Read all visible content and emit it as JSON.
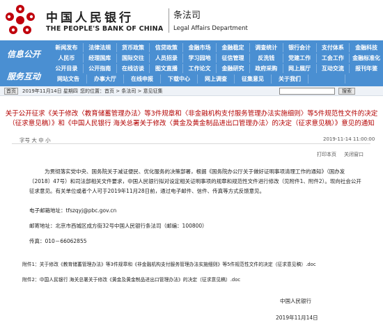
{
  "header": {
    "bank_zh": "中国人民银行",
    "bank_en": "THE PEOPLE'S BANK OF CHINA",
    "dept_zh": "条法司",
    "dept_en": "Legal Affairs Department",
    "brand_color": "#c0000c"
  },
  "nav": {
    "section1": "信息公开",
    "section2": "服务互动",
    "rows": [
      [
        "新闻发布",
        "法律法规",
        "货币政策",
        "信贷政策",
        "金融市场",
        "金融稳定",
        "调查统计",
        "银行会计",
        "支付体系",
        "金融科技"
      ],
      [
        "人民币",
        "经理国库",
        "国际交往",
        "人员招录",
        "学习园地",
        "征信管理",
        "反洗钱",
        "党建工作",
        "工会工作",
        "金融标准化"
      ],
      [
        "公开目录",
        "公开指南",
        "在线访谈",
        "图文直播",
        "工作论文",
        "金融研究",
        "政府采购",
        "网上展厅",
        "互动交流",
        "报刊年鉴"
      ],
      [
        "网站文告",
        "办事大厅",
        "在线申报",
        "下载中心",
        "网上调查",
        "征集意见",
        "关于我们",
        "",
        ""
      ]
    ],
    "accent": "#4a8fd2"
  },
  "breadcrumb": {
    "home_btn": "首页",
    "date": "2019年11月14日 星期四",
    "location": "您的位置：首页 > 条法司 > 意见征集",
    "search_btn": "搜索"
  },
  "article": {
    "title": "关于公开征求《关于修改〈教育储蓄管理办法〉等3件规章和〈非金融机构支付服务管理办法实施细则〉等5件规范性文件的决定（征求意见稿）》和《中国人民银行 海关总署关于修改〈黄金及黄金制品进出口管理办法〉的决定（征求意见稿）》意见的通知",
    "font_label": "字号 大 中 小",
    "date": "2019-11-14 11:00:00",
    "print": "打印本页",
    "close": "关闭窗口",
    "body": "为贯彻落实党中央、国务院关于减证便民、优化服务的决策部署，根据《国务院办公厅关于做好证明事项清理工作的通知》（国办发〔2018〕47号）和司法部相关文件要求，中国人民银行拟对设定相关证明事项的规章和规范性文件进行修改（见附件1、附件2）。现向社会公开征求意见。有关单位或者个人可于2019年11月28日前，通过电子邮件、信件、传真等方式反馈意见。",
    "email": "电子邮箱地址：tfszqyj@pbc.gov.cn",
    "address": "邮寄地址：北京市西城区成方街32号中国人民银行条法司（邮编：100800）",
    "fax": "传真：010－66062855",
    "attach1": "附件1：关于修改《教育储蓄管理办法》等3件规章和《非金融机构支付服务管理办法实施细则》等5件规范性文件的决定（征求意见稿）.doc",
    "attach2": "附件2：中国人民银行 海关总署关于修改《黄金及黄金制品进出口管理办法》的决定（征求意见稿）.doc",
    "signer": "中国人民银行",
    "sign_date": "2019年11月14日"
  }
}
